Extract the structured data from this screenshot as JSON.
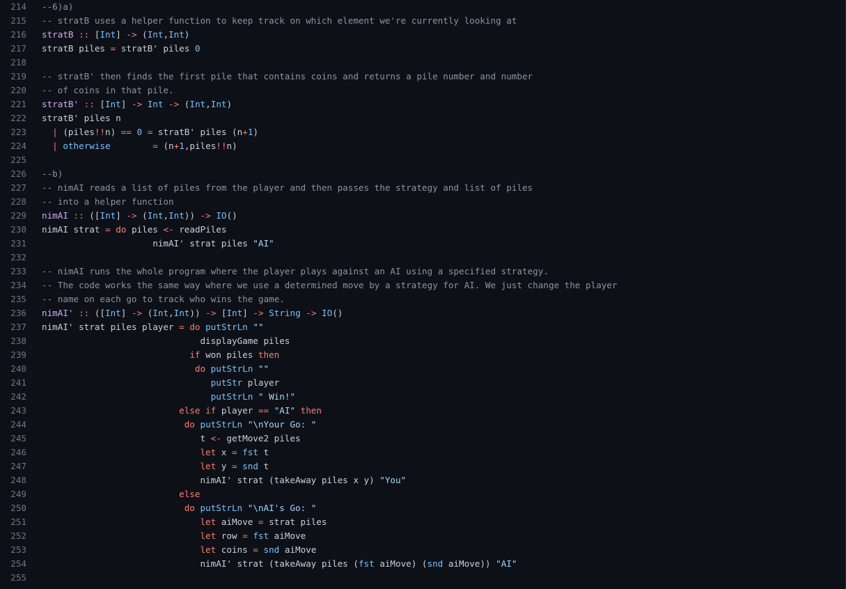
{
  "editor": {
    "language": "haskell",
    "theme": "github-dark",
    "background_color": "#0d1117",
    "default_text_color": "#c9d1d9",
    "gutter_color": "#6e7681",
    "first_line": 214,
    "last_line": 255,
    "line_height_px": 20,
    "font_size_px": 12.6
  },
  "token_colors": {
    "comment": "#8b949e",
    "keyword": "#ff7b72",
    "operator": "#ff7b72",
    "type": "#79c0ff",
    "number": "#79c0ff",
    "string": "#a5d6ff",
    "function": "#79c0ff",
    "definition": "#d2a8ff",
    "plain": "#c9d1d9"
  },
  "lines": [
    {
      "number": "214",
      "tokens": [
        {
          "t": "--6)a)",
          "c": "comment"
        }
      ]
    },
    {
      "number": "215",
      "tokens": [
        {
          "t": "-- stratB uses a helper function to keep track on which element we're currently looking at",
          "c": "comment"
        }
      ]
    },
    {
      "number": "216",
      "tokens": [
        {
          "t": "stratB",
          "c": "def"
        },
        {
          "t": " ",
          "c": "plain"
        },
        {
          "t": "::",
          "c": "operator"
        },
        {
          "t": " [",
          "c": "plain"
        },
        {
          "t": "Int",
          "c": "type"
        },
        {
          "t": "] ",
          "c": "plain"
        },
        {
          "t": "->",
          "c": "operator"
        },
        {
          "t": " (",
          "c": "plain"
        },
        {
          "t": "Int",
          "c": "type"
        },
        {
          "t": ",",
          "c": "plain"
        },
        {
          "t": "Int",
          "c": "type"
        },
        {
          "t": ")",
          "c": "plain"
        }
      ]
    },
    {
      "number": "217",
      "tokens": [
        {
          "t": "stratB piles ",
          "c": "plain"
        },
        {
          "t": "=",
          "c": "operator"
        },
        {
          "t": " stratB' piles ",
          "c": "plain"
        },
        {
          "t": "0",
          "c": "number"
        }
      ]
    },
    {
      "number": "218",
      "tokens": []
    },
    {
      "number": "219",
      "tokens": [
        {
          "t": "-- stratB' then finds the first pile that contains coins and returns a pile number and number",
          "c": "comment"
        }
      ]
    },
    {
      "number": "220",
      "tokens": [
        {
          "t": "-- of coins in that pile.",
          "c": "comment"
        }
      ]
    },
    {
      "number": "221",
      "tokens": [
        {
          "t": "stratB'",
          "c": "def"
        },
        {
          "t": " ",
          "c": "plain"
        },
        {
          "t": "::",
          "c": "operator"
        },
        {
          "t": " [",
          "c": "plain"
        },
        {
          "t": "Int",
          "c": "type"
        },
        {
          "t": "] ",
          "c": "plain"
        },
        {
          "t": "->",
          "c": "operator"
        },
        {
          "t": " ",
          "c": "plain"
        },
        {
          "t": "Int",
          "c": "type"
        },
        {
          "t": " ",
          "c": "plain"
        },
        {
          "t": "->",
          "c": "operator"
        },
        {
          "t": " (",
          "c": "plain"
        },
        {
          "t": "Int",
          "c": "type"
        },
        {
          "t": ",",
          "c": "plain"
        },
        {
          "t": "Int",
          "c": "type"
        },
        {
          "t": ")",
          "c": "plain"
        }
      ]
    },
    {
      "number": "222",
      "tokens": [
        {
          "t": "stratB' piles n",
          "c": "plain"
        }
      ]
    },
    {
      "number": "223",
      "tokens": [
        {
          "t": "  ",
          "c": "plain"
        },
        {
          "t": "|",
          "c": "guard"
        },
        {
          "t": " (piles",
          "c": "plain"
        },
        {
          "t": "!!",
          "c": "operator"
        },
        {
          "t": "n) ",
          "c": "plain"
        },
        {
          "t": "==",
          "c": "operator"
        },
        {
          "t": " ",
          "c": "plain"
        },
        {
          "t": "0",
          "c": "number"
        },
        {
          "t": " ",
          "c": "plain"
        },
        {
          "t": "=",
          "c": "operator"
        },
        {
          "t": " stratB' piles (n",
          "c": "plain"
        },
        {
          "t": "+",
          "c": "operator"
        },
        {
          "t": "1",
          "c": "number"
        },
        {
          "t": ")",
          "c": "plain"
        }
      ]
    },
    {
      "number": "224",
      "tokens": [
        {
          "t": "  ",
          "c": "plain"
        },
        {
          "t": "|",
          "c": "guard"
        },
        {
          "t": " ",
          "c": "plain"
        },
        {
          "t": "otherwise",
          "c": "func"
        },
        {
          "t": "        ",
          "c": "plain"
        },
        {
          "t": "=",
          "c": "operator"
        },
        {
          "t": " (n",
          "c": "plain"
        },
        {
          "t": "+",
          "c": "operator"
        },
        {
          "t": "1",
          "c": "number"
        },
        {
          "t": ",piles",
          "c": "plain"
        },
        {
          "t": "!!",
          "c": "operator"
        },
        {
          "t": "n)",
          "c": "plain"
        }
      ]
    },
    {
      "number": "225",
      "tokens": []
    },
    {
      "number": "226",
      "tokens": [
        {
          "t": "--b)",
          "c": "comment"
        }
      ]
    },
    {
      "number": "227",
      "tokens": [
        {
          "t": "-- nimAI reads a list of piles from the player and then passes the strategy and list of piles",
          "c": "comment"
        }
      ]
    },
    {
      "number": "228",
      "tokens": [
        {
          "t": "-- into a helper function",
          "c": "comment"
        }
      ]
    },
    {
      "number": "229",
      "tokens": [
        {
          "t": "nimAI",
          "c": "def"
        },
        {
          "t": " ",
          "c": "plain"
        },
        {
          "t": "::",
          "c": "operator"
        },
        {
          "t": " ([",
          "c": "plain"
        },
        {
          "t": "Int",
          "c": "type"
        },
        {
          "t": "] ",
          "c": "plain"
        },
        {
          "t": "->",
          "c": "operator"
        },
        {
          "t": " (",
          "c": "plain"
        },
        {
          "t": "Int",
          "c": "type"
        },
        {
          "t": ",",
          "c": "plain"
        },
        {
          "t": "Int",
          "c": "type"
        },
        {
          "t": ")) ",
          "c": "plain"
        },
        {
          "t": "->",
          "c": "operator"
        },
        {
          "t": " ",
          "c": "plain"
        },
        {
          "t": "IO",
          "c": "type"
        },
        {
          "t": "()",
          "c": "plain"
        }
      ]
    },
    {
      "number": "230",
      "tokens": [
        {
          "t": "nimAI strat ",
          "c": "plain"
        },
        {
          "t": "=",
          "c": "operator"
        },
        {
          "t": " ",
          "c": "plain"
        },
        {
          "t": "do",
          "c": "keyword"
        },
        {
          "t": " piles ",
          "c": "plain"
        },
        {
          "t": "<-",
          "c": "operator"
        },
        {
          "t": " readPiles",
          "c": "plain"
        }
      ]
    },
    {
      "number": "231",
      "tokens": [
        {
          "t": "                     nimAI' strat piles ",
          "c": "plain"
        },
        {
          "t": "\"AI\"",
          "c": "string"
        }
      ]
    },
    {
      "number": "232",
      "tokens": []
    },
    {
      "number": "233",
      "tokens": [
        {
          "t": "-- nimAI runs the whole program where the player plays against an AI using a specified strategy.",
          "c": "comment"
        }
      ]
    },
    {
      "number": "234",
      "tokens": [
        {
          "t": "-- The code works the same way where we use a determined move by a strategy for AI. We just change the player",
          "c": "comment"
        }
      ]
    },
    {
      "number": "235",
      "tokens": [
        {
          "t": "-- name on each go to track who wins the game.",
          "c": "comment"
        }
      ]
    },
    {
      "number": "236",
      "tokens": [
        {
          "t": "nimAI'",
          "c": "def"
        },
        {
          "t": " ",
          "c": "plain"
        },
        {
          "t": "::",
          "c": "operator"
        },
        {
          "t": " ([",
          "c": "plain"
        },
        {
          "t": "Int",
          "c": "type"
        },
        {
          "t": "] ",
          "c": "plain"
        },
        {
          "t": "->",
          "c": "operator"
        },
        {
          "t": " (",
          "c": "plain"
        },
        {
          "t": "Int",
          "c": "type"
        },
        {
          "t": ",",
          "c": "plain"
        },
        {
          "t": "Int",
          "c": "type"
        },
        {
          "t": ")) ",
          "c": "plain"
        },
        {
          "t": "->",
          "c": "operator"
        },
        {
          "t": " [",
          "c": "plain"
        },
        {
          "t": "Int",
          "c": "type"
        },
        {
          "t": "] ",
          "c": "plain"
        },
        {
          "t": "->",
          "c": "operator"
        },
        {
          "t": " ",
          "c": "plain"
        },
        {
          "t": "String",
          "c": "type"
        },
        {
          "t": " ",
          "c": "plain"
        },
        {
          "t": "->",
          "c": "operator"
        },
        {
          "t": " ",
          "c": "plain"
        },
        {
          "t": "IO",
          "c": "type"
        },
        {
          "t": "()",
          "c": "plain"
        }
      ]
    },
    {
      "number": "237",
      "tokens": [
        {
          "t": "nimAI' strat piles player ",
          "c": "plain"
        },
        {
          "t": "=",
          "c": "operator"
        },
        {
          "t": " ",
          "c": "plain"
        },
        {
          "t": "do",
          "c": "keyword"
        },
        {
          "t": " ",
          "c": "plain"
        },
        {
          "t": "putStrLn",
          "c": "func"
        },
        {
          "t": " ",
          "c": "plain"
        },
        {
          "t": "\"\"",
          "c": "string"
        }
      ]
    },
    {
      "number": "238",
      "tokens": [
        {
          "t": "                              displayGame piles",
          "c": "plain"
        }
      ]
    },
    {
      "number": "239",
      "tokens": [
        {
          "t": "                            ",
          "c": "plain"
        },
        {
          "t": "if",
          "c": "keyword"
        },
        {
          "t": " won piles ",
          "c": "plain"
        },
        {
          "t": "then",
          "c": "keyword"
        }
      ]
    },
    {
      "number": "240",
      "tokens": [
        {
          "t": "                             ",
          "c": "plain"
        },
        {
          "t": "do",
          "c": "keyword"
        },
        {
          "t": " ",
          "c": "plain"
        },
        {
          "t": "putStrLn",
          "c": "func"
        },
        {
          "t": " ",
          "c": "plain"
        },
        {
          "t": "\"\"",
          "c": "string"
        }
      ]
    },
    {
      "number": "241",
      "tokens": [
        {
          "t": "                                ",
          "c": "plain"
        },
        {
          "t": "putStr",
          "c": "func"
        },
        {
          "t": " player",
          "c": "plain"
        }
      ]
    },
    {
      "number": "242",
      "tokens": [
        {
          "t": "                                ",
          "c": "plain"
        },
        {
          "t": "putStrLn",
          "c": "func"
        },
        {
          "t": " ",
          "c": "plain"
        },
        {
          "t": "\" Win!\"",
          "c": "string"
        }
      ]
    },
    {
      "number": "243",
      "tokens": [
        {
          "t": "                          ",
          "c": "plain"
        },
        {
          "t": "else",
          "c": "keyword"
        },
        {
          "t": " ",
          "c": "plain"
        },
        {
          "t": "if",
          "c": "keyword"
        },
        {
          "t": " player ",
          "c": "plain"
        },
        {
          "t": "==",
          "c": "operator"
        },
        {
          "t": " ",
          "c": "plain"
        },
        {
          "t": "\"AI\"",
          "c": "string"
        },
        {
          "t": " ",
          "c": "plain"
        },
        {
          "t": "then",
          "c": "keyword"
        }
      ]
    },
    {
      "number": "244",
      "tokens": [
        {
          "t": "                           ",
          "c": "plain"
        },
        {
          "t": "do",
          "c": "keyword"
        },
        {
          "t": " ",
          "c": "plain"
        },
        {
          "t": "putStrLn",
          "c": "func"
        },
        {
          "t": " ",
          "c": "plain"
        },
        {
          "t": "\"\\nYour Go: \"",
          "c": "string"
        }
      ]
    },
    {
      "number": "245",
      "tokens": [
        {
          "t": "                              t ",
          "c": "plain"
        },
        {
          "t": "<-",
          "c": "operator"
        },
        {
          "t": " getMove2 piles",
          "c": "plain"
        }
      ]
    },
    {
      "number": "246",
      "tokens": [
        {
          "t": "                              ",
          "c": "plain"
        },
        {
          "t": "let",
          "c": "keyword"
        },
        {
          "t": " x ",
          "c": "plain"
        },
        {
          "t": "=",
          "c": "operator"
        },
        {
          "t": " ",
          "c": "plain"
        },
        {
          "t": "fst",
          "c": "func"
        },
        {
          "t": " t",
          "c": "plain"
        }
      ]
    },
    {
      "number": "247",
      "tokens": [
        {
          "t": "                              ",
          "c": "plain"
        },
        {
          "t": "let",
          "c": "keyword"
        },
        {
          "t": " y ",
          "c": "plain"
        },
        {
          "t": "=",
          "c": "operator"
        },
        {
          "t": " ",
          "c": "plain"
        },
        {
          "t": "snd",
          "c": "func"
        },
        {
          "t": " t",
          "c": "plain"
        }
      ]
    },
    {
      "number": "248",
      "tokens": [
        {
          "t": "                              nimAI' strat (takeAway piles x y) ",
          "c": "plain"
        },
        {
          "t": "\"You\"",
          "c": "string"
        }
      ]
    },
    {
      "number": "249",
      "tokens": [
        {
          "t": "                          ",
          "c": "plain"
        },
        {
          "t": "else",
          "c": "keyword"
        }
      ]
    },
    {
      "number": "250",
      "tokens": [
        {
          "t": "                           ",
          "c": "plain"
        },
        {
          "t": "do",
          "c": "keyword"
        },
        {
          "t": " ",
          "c": "plain"
        },
        {
          "t": "putStrLn",
          "c": "func"
        },
        {
          "t": " ",
          "c": "plain"
        },
        {
          "t": "\"\\nAI's Go: \"",
          "c": "string"
        }
      ]
    },
    {
      "number": "251",
      "tokens": [
        {
          "t": "                              ",
          "c": "plain"
        },
        {
          "t": "let",
          "c": "keyword"
        },
        {
          "t": " aiMove ",
          "c": "plain"
        },
        {
          "t": "=",
          "c": "operator"
        },
        {
          "t": " strat piles",
          "c": "plain"
        }
      ]
    },
    {
      "number": "252",
      "tokens": [
        {
          "t": "                              ",
          "c": "plain"
        },
        {
          "t": "let",
          "c": "keyword"
        },
        {
          "t": " row ",
          "c": "plain"
        },
        {
          "t": "=",
          "c": "operator"
        },
        {
          "t": " ",
          "c": "plain"
        },
        {
          "t": "fst",
          "c": "func"
        },
        {
          "t": " aiMove",
          "c": "plain"
        }
      ]
    },
    {
      "number": "253",
      "tokens": [
        {
          "t": "                              ",
          "c": "plain"
        },
        {
          "t": "let",
          "c": "keyword"
        },
        {
          "t": " coins ",
          "c": "plain"
        },
        {
          "t": "=",
          "c": "operator"
        },
        {
          "t": " ",
          "c": "plain"
        },
        {
          "t": "snd",
          "c": "func"
        },
        {
          "t": " aiMove",
          "c": "plain"
        }
      ]
    },
    {
      "number": "254",
      "tokens": [
        {
          "t": "                              nimAI' strat (takeAway piles (",
          "c": "plain"
        },
        {
          "t": "fst",
          "c": "func"
        },
        {
          "t": " aiMove) (",
          "c": "plain"
        },
        {
          "t": "snd",
          "c": "func"
        },
        {
          "t": " aiMove)) ",
          "c": "plain"
        },
        {
          "t": "\"AI\"",
          "c": "string"
        }
      ]
    },
    {
      "number": "255",
      "tokens": []
    }
  ]
}
